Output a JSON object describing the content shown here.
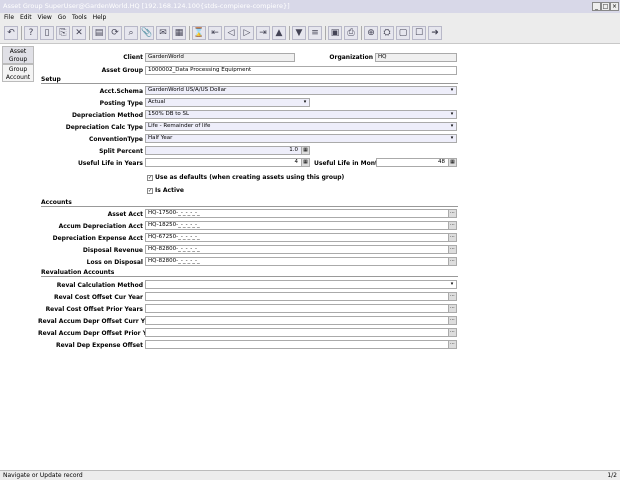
{
  "window": {
    "title": "Asset Group  SuperUser@GardenWorld.HQ [192.168.124.100{stds-compiere-compiere}]",
    "minimize": "_",
    "maximize": "□",
    "close": "×"
  },
  "menu": [
    "File",
    "Edit",
    "View",
    "Go",
    "Tools",
    "Help"
  ],
  "toolbar": [
    "undo",
    "help",
    "new",
    "copy",
    "delete",
    "save",
    "refresh",
    "find",
    "attachment",
    "chat",
    "grid",
    "history",
    "first",
    "previous",
    "next",
    "last",
    "parent",
    "detail",
    "report",
    "archive",
    "print",
    "zoom",
    "workflow",
    "product",
    "request",
    "exit"
  ],
  "toolbar_glyphs": [
    "↶",
    "?",
    "▯",
    "⎘",
    "✕",
    "▤",
    "⟳",
    "⌕",
    "📎",
    "✉",
    "▦",
    "⌛",
    "⇤",
    "◁",
    "▷",
    "⇥",
    "▲",
    "▼",
    "≡",
    "▣",
    "⎙",
    "⊕",
    "⛭",
    "▢",
    "☐",
    "➜"
  ],
  "side_tabs": [
    "Asset Group",
    "Group Account"
  ],
  "header": {
    "client_label": "Client",
    "client_value": "GardenWorld",
    "org_label": "Organization",
    "org_value": "HQ",
    "asset_group_label": "Asset Group",
    "asset_group_value": "1000002_Data Processing Equipment"
  },
  "setup": {
    "section_title": "Setup",
    "acct_schema_label": "Acct.Schema",
    "acct_schema_value": "GardenWorld US/A/US Dollar",
    "posting_type_label": "Posting Type",
    "posting_type_value": "Actual",
    "depreciation_method_label": "Depreciation Method",
    "depreciation_method_value": "150% DB to SL",
    "depr_calc_type_label": "Depreciation Calc Type",
    "depr_calc_type_value": "Life - Remainder of life",
    "convention_label": "ConventionType",
    "convention_value": "Half Year",
    "split_percent_label": "Split Percent",
    "split_percent_value": "1.0",
    "useful_life_years_label": "Useful Life in Years",
    "useful_life_years_value": "4",
    "useful_life_months_label": "Useful Life in Months",
    "useful_life_months_value": "48",
    "use_defaults_label": "Use as defaults (when creating assets using this group)",
    "is_active_label": "Is Active",
    "check_mark": "✓"
  },
  "accounts": {
    "section_title": "Accounts",
    "rows": [
      {
        "label": "Asset Acct",
        "value": "HQ-17500-_-_-_-_-_"
      },
      {
        "label": "Accum Depreciation Acct",
        "value": "HQ-18250-_-_-_-_-_"
      },
      {
        "label": "Depreciation Expense Acct",
        "value": "HQ-67250-_-_-_-_-_"
      },
      {
        "label": "Disposal Revenue",
        "value": "HQ-82800-_-_-_-_-_"
      },
      {
        "label": "Loss on Disposal",
        "value": "HQ-82800-_-_-_-_-_"
      }
    ]
  },
  "revaluation": {
    "section_title": "Revaluation Accounts",
    "calc_method_label": "Reval Calculation Method",
    "rows": [
      {
        "label": "Reval Cost Offset Cur Year"
      },
      {
        "label": "Reval Cost Offset Prior Years"
      },
      {
        "label": "Reval Accum Depr Offset Curr Year"
      },
      {
        "label": "Reval Accum Depr Offset Prior Years"
      },
      {
        "label": "Reval Dep Expense Offset"
      }
    ]
  },
  "status": {
    "message": "Navigate or Update record",
    "record": "1/2"
  },
  "icons": {
    "dropdown": "▾",
    "lookup": "⋯",
    "calc": "▦"
  }
}
